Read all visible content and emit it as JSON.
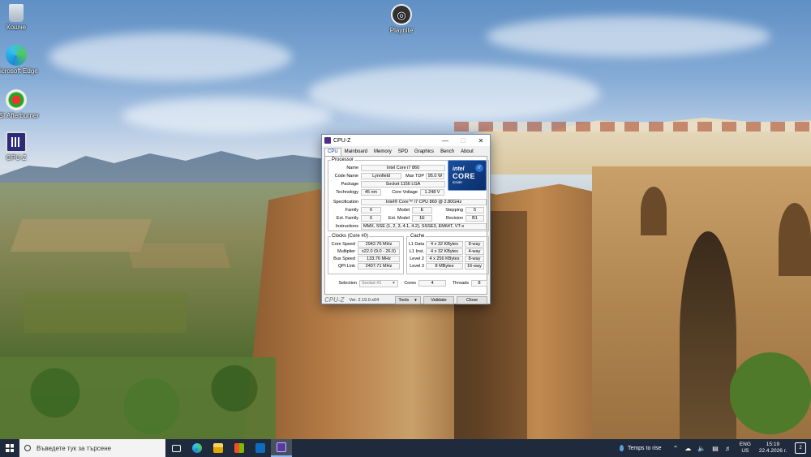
{
  "desktop": {
    "icons": [
      {
        "label": "Кошче",
        "icon": "recycle-bin-icon"
      },
      {
        "label": "Microsoft Edge",
        "icon": "edge-icon"
      },
      {
        "label": "MSI Afterburner",
        "icon": "afterburner-icon"
      },
      {
        "label": "GPU-Z",
        "icon": "gpuz-icon"
      },
      {
        "label": "Playnite",
        "icon": "playnite-icon"
      }
    ]
  },
  "window": {
    "title": "CPU-Z",
    "tabs": [
      "CPU",
      "Mainboard",
      "Memory",
      "SPD",
      "Graphics",
      "Bench",
      "About"
    ],
    "active_tab": "CPU",
    "processor_legend": "Processor",
    "fields": {
      "name_label": "Name",
      "name": "Intel Core i7 860",
      "codename_label": "Code Name",
      "codename": "Lynnfield",
      "maxtdp_label": "Max TDP",
      "maxtdp": "95.0 W",
      "package_label": "Package",
      "package": "Socket 1156 LGA",
      "technology_label": "Technology",
      "technology": "45 nm",
      "corevoltage_label": "Core Voltage",
      "corevoltage": "1.248 V",
      "spec_label": "Specification",
      "spec": "Intel® Core™ i7 CPU       860  @ 2.80GHz",
      "family_label": "Family",
      "family": "6",
      "model_label": "Model",
      "model": "E",
      "stepping_label": "Stepping",
      "stepping": "5",
      "extfamily_label": "Ext. Family",
      "extfamily": "6",
      "extmodel_label": "Ext. Model",
      "extmodel": "1E",
      "revision_label": "Revision",
      "revision": "B1",
      "instructions_label": "Instructions",
      "instructions": "MMX, SSE (1, 2, 3, 4.1, 4.2), SSSE3, EM64T, VT-x"
    },
    "logo": {
      "brand": "intel",
      "core": "CORE",
      "inside": "inside",
      "badge": "i7"
    },
    "clocks": {
      "legend": "Clocks (Core #0)",
      "corespeed_label": "Core Speed",
      "corespeed": "2942.76 MHz",
      "multiplier_label": "Multiplier",
      "multiplier": "x22.0 (9.0 - 26.0)",
      "busspeed_label": "Bus Speed",
      "busspeed": "133.76 MHz",
      "qpilink_label": "QPI Link",
      "qpilink": "2407.71 MHz"
    },
    "cache": {
      "legend": "Cache",
      "rows": [
        {
          "label": "L1 Data",
          "size": "4 x 32 KBytes",
          "way": "8-way"
        },
        {
          "label": "L1 Inst.",
          "size": "4 x 32 KBytes",
          "way": "4-way"
        },
        {
          "label": "Level 2",
          "size": "4 x 256 KBytes",
          "way": "8-way"
        },
        {
          "label": "Level 3",
          "size": "8 MBytes",
          "way": "16-way"
        }
      ]
    },
    "selection_label": "Selection",
    "selection": "Socket #1",
    "cores_label": "Cores",
    "cores": "4",
    "threads_label": "Threads",
    "threads": "8",
    "footer": {
      "logo": "CPU-Z",
      "version": "Ver. 2.19.0.x64",
      "tools": "Tools",
      "validate": "Validate",
      "close": "Close"
    }
  },
  "taskbar": {
    "search_placeholder": "Въведете тук за търсене",
    "weather": "Temps to rise",
    "lang_top": "ENG",
    "lang_bottom": "US",
    "time": "15:19",
    "date": "22.4.2026 г.",
    "notifications": "2"
  }
}
